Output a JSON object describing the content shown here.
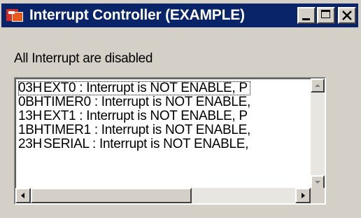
{
  "window": {
    "title": "Interrupt Controller (EXAMPLE)"
  },
  "status_text": "All Interrupt are disabled",
  "interrupt_list": [
    {
      "address": "03H",
      "text": "EXT0 : Interrupt is NOT ENABLE,  P"
    },
    {
      "address": "0BH",
      "text": "TIMER0 : Interrupt is NOT ENABLE,"
    },
    {
      "address": "13H",
      "text": "EXT1 : Interrupt is NOT ENABLE,  P"
    },
    {
      "address": "1BH",
      "text": "TIMER1 : Interrupt is NOT ENABLE,"
    },
    {
      "address": "23H",
      "text": "SERIAL : Interrupt is NOT ENABLE,"
    }
  ],
  "icons": {
    "app": "interrupt-app-icon",
    "minimize": "minimize-icon",
    "maximize": "maximize-icon",
    "close": "close-icon"
  },
  "colors": {
    "titlebar": "#0a246a",
    "face": "#d4d0c8"
  }
}
